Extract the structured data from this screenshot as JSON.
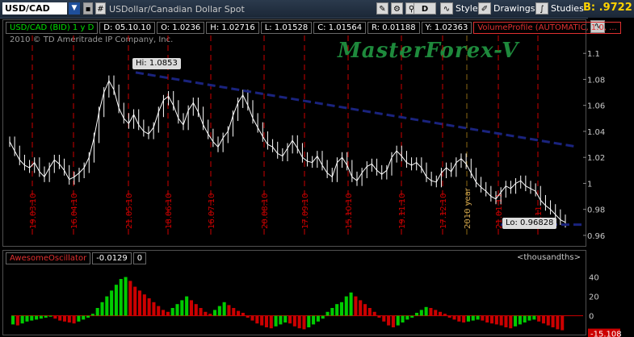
{
  "toolbar": {
    "symbol": "USD/CAD",
    "description": "USDollar/Canadian Dollar Spot",
    "period_button": "D",
    "style_label": "Style",
    "drawings_label": "Drawings",
    "studies_label": "Studies",
    "bid_label": "B: .9722"
  },
  "info_bar": {
    "series_label": "USD/CAD (BID) 1 y D",
    "date": "D: 05.10.10",
    "open": "O: 1.0236",
    "high": "H: 1.02716",
    "low": "L: 1.01528",
    "close": "C: 1.01564",
    "range": "R: 0.01188",
    "y": "Y: 1.02363",
    "study": "VolumeProfile (AUTOMATIC, 1.0, ..."
  },
  "copyright": "2010 © TD Ameritrade IP Company, Inc.",
  "watermark": "MasterForex-V",
  "colors": {
    "up_bar": "#ffffff",
    "down_bar": "#ffffff",
    "trendline": "#1a237e",
    "vline": "#cc0000",
    "osc_up": "#00cc00",
    "osc_down": "#cc0000",
    "year_line": "#8b6914",
    "bid": "#ffd200"
  },
  "chart_data": [
    {
      "type": "line",
      "ylim": [
        0.955,
        1.115
      ],
      "yticks": [
        "1.1",
        "1.08",
        "1.06",
        "1.04",
        "1.02",
        "1",
        "0.98",
        "0.96"
      ],
      "ytick_values": [
        1.1,
        1.08,
        1.06,
        1.04,
        1.02,
        1.0,
        0.98,
        0.96
      ],
      "date_markers": [
        "19.03.10",
        "16.04.10",
        "21.05.10",
        "18.06.10",
        "16.07.10",
        "20.08.10",
        "17.09.10",
        "15.10.10",
        "19.11.10",
        "17.12.10",
        "2010 year",
        "21.01.11",
        "22.11"
      ],
      "hi_label": "Hi: 1.0853",
      "lo_label": "Lo: 0.96828",
      "hi_value": 1.0853,
      "lo_value": 0.96828,
      "series": [
        {
          "values": [
            1.032,
            1.025,
            1.018,
            1.014,
            1.012,
            1.016,
            1.009,
            1.005,
            1.012,
            1.018,
            1.015,
            1.01,
            1.003,
            1.005,
            1.008,
            1.012,
            1.02,
            1.035,
            1.055,
            1.07,
            1.079,
            1.072,
            1.058,
            1.05,
            1.046,
            1.053,
            1.045,
            1.04,
            1.038,
            1.043,
            1.055,
            1.064,
            1.067,
            1.06,
            1.05,
            1.045,
            1.056,
            1.062,
            1.055,
            1.045,
            1.038,
            1.032,
            1.028,
            1.035,
            1.04,
            1.052,
            1.062,
            1.068,
            1.06,
            1.05,
            1.043,
            1.036,
            1.03,
            1.028,
            1.023,
            1.021,
            1.027,
            1.033,
            1.027,
            1.02,
            1.017,
            1.016,
            1.021,
            1.014,
            1.008,
            1.005,
            1.016,
            1.02,
            1.014,
            1.005,
            1.002,
            1.008,
            1.013,
            1.015,
            1.01,
            1.007,
            1.01,
            1.02,
            1.025,
            1.021,
            1.016,
            1.014,
            1.016,
            1.012,
            1.005,
            1.002,
            1.001,
            1.008,
            1.012,
            1.009,
            1.016,
            1.019,
            1.015,
            1.008,
            1.001,
            0.997,
            0.994,
            0.99,
            0.988,
            0.993,
            0.998,
            0.996,
            1.0,
            1.002,
            0.998,
            0.996,
            0.994,
            0.987,
            0.983,
            0.98,
            0.976,
            0.972,
            0.97
          ]
        }
      ]
    },
    {
      "type": "bar",
      "title": "AwesomeOscillator",
      "current_value": "-0.0129",
      "second_value": "0",
      "unit_label": "<thousandths>",
      "ylim": [
        -17,
        48
      ],
      "yticks": [
        "40",
        "20",
        "0"
      ],
      "ytick_values": [
        40,
        20,
        0
      ],
      "last_value_label": "-15.108",
      "values": [
        -9,
        -10,
        -8,
        -6,
        -5,
        -4,
        -3,
        -2,
        -1,
        -3,
        -5,
        -6,
        -7,
        -8,
        -6,
        -4,
        -2,
        2,
        8,
        14,
        20,
        26,
        32,
        38,
        40,
        36,
        30,
        26,
        22,
        18,
        14,
        10,
        6,
        4,
        8,
        12,
        16,
        20,
        16,
        12,
        8,
        4,
        2,
        6,
        10,
        14,
        11,
        8,
        5,
        3,
        -2,
        -5,
        -8,
        -10,
        -12,
        -13,
        -11,
        -9,
        -7,
        -8,
        -11,
        -13,
        -14,
        -12,
        -9,
        -6,
        -3,
        4,
        8,
        12,
        14,
        20,
        24,
        20,
        16,
        12,
        8,
        4,
        -2,
        -6,
        -10,
        -12,
        -10,
        -7,
        -4,
        -2,
        3,
        6,
        9,
        8,
        6,
        4,
        2,
        -2,
        -4,
        -6,
        -7,
        -6,
        -5,
        -4,
        -5,
        -7,
        -8,
        -9,
        -10,
        -12,
        -13,
        -11,
        -9,
        -7,
        -5,
        -4,
        -6,
        -8,
        -10,
        -12,
        -14,
        -15
      ]
    }
  ]
}
